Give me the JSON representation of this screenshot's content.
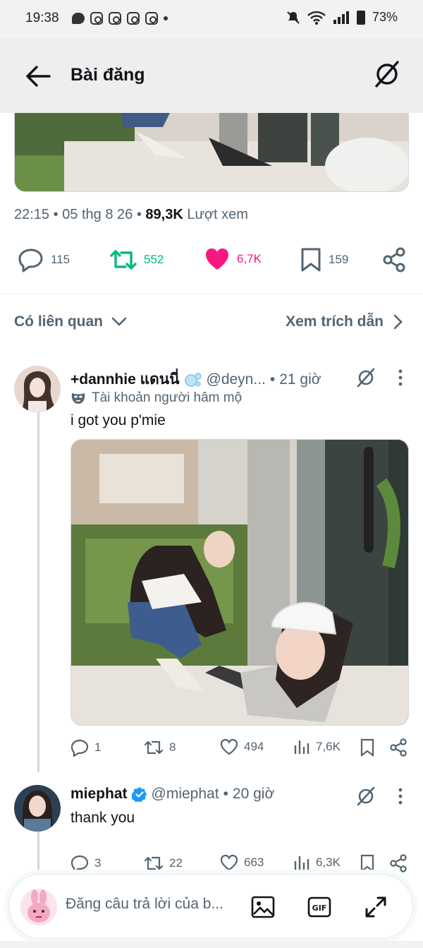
{
  "status_bar": {
    "time": "19:38",
    "battery": "73%"
  },
  "header": {
    "title": "Bài đăng"
  },
  "post": {
    "time": "22:15",
    "date": "05 thg 8 26",
    "views": "89,3K",
    "views_label": "Lượt xem",
    "replies": "115",
    "reposts": "552",
    "likes": "6,7K",
    "bookmarks": "159"
  },
  "related": {
    "left_label": "Có liên quan",
    "right_label": "Xem trích dẫn"
  },
  "tweets": [
    {
      "name": "+dannhie แดนนี่",
      "handle": "@deyn...",
      "age": "21 giờ",
      "fan_label": "Tài khoản người hâm mộ",
      "text": "i got you p'mie",
      "replies": "1",
      "reposts": "8",
      "likes": "494",
      "views": "7,6K"
    },
    {
      "name": "miephat",
      "handle": "@miephat",
      "age": "20 giờ",
      "text": "thank you",
      "replies": "3",
      "reposts": "22",
      "likes": "663",
      "views": "6,3K"
    }
  ],
  "composer": {
    "placeholder": "Đăng câu trả lời của b..."
  },
  "colors": {
    "repost_green": "#00ba7c",
    "like_pink": "#f91880",
    "verified_blue": "#1d9bf0"
  },
  "icons": [
    "back-arrow-icon",
    "grok-icon",
    "reply-icon",
    "repost-icon",
    "heart-icon",
    "bookmark-icon",
    "share-icon",
    "chevron-down-icon",
    "chevron-right-icon",
    "more-icon",
    "views-icon",
    "image-icon",
    "gif-icon",
    "expand-icon",
    "verified-icon",
    "mask-icon"
  ]
}
